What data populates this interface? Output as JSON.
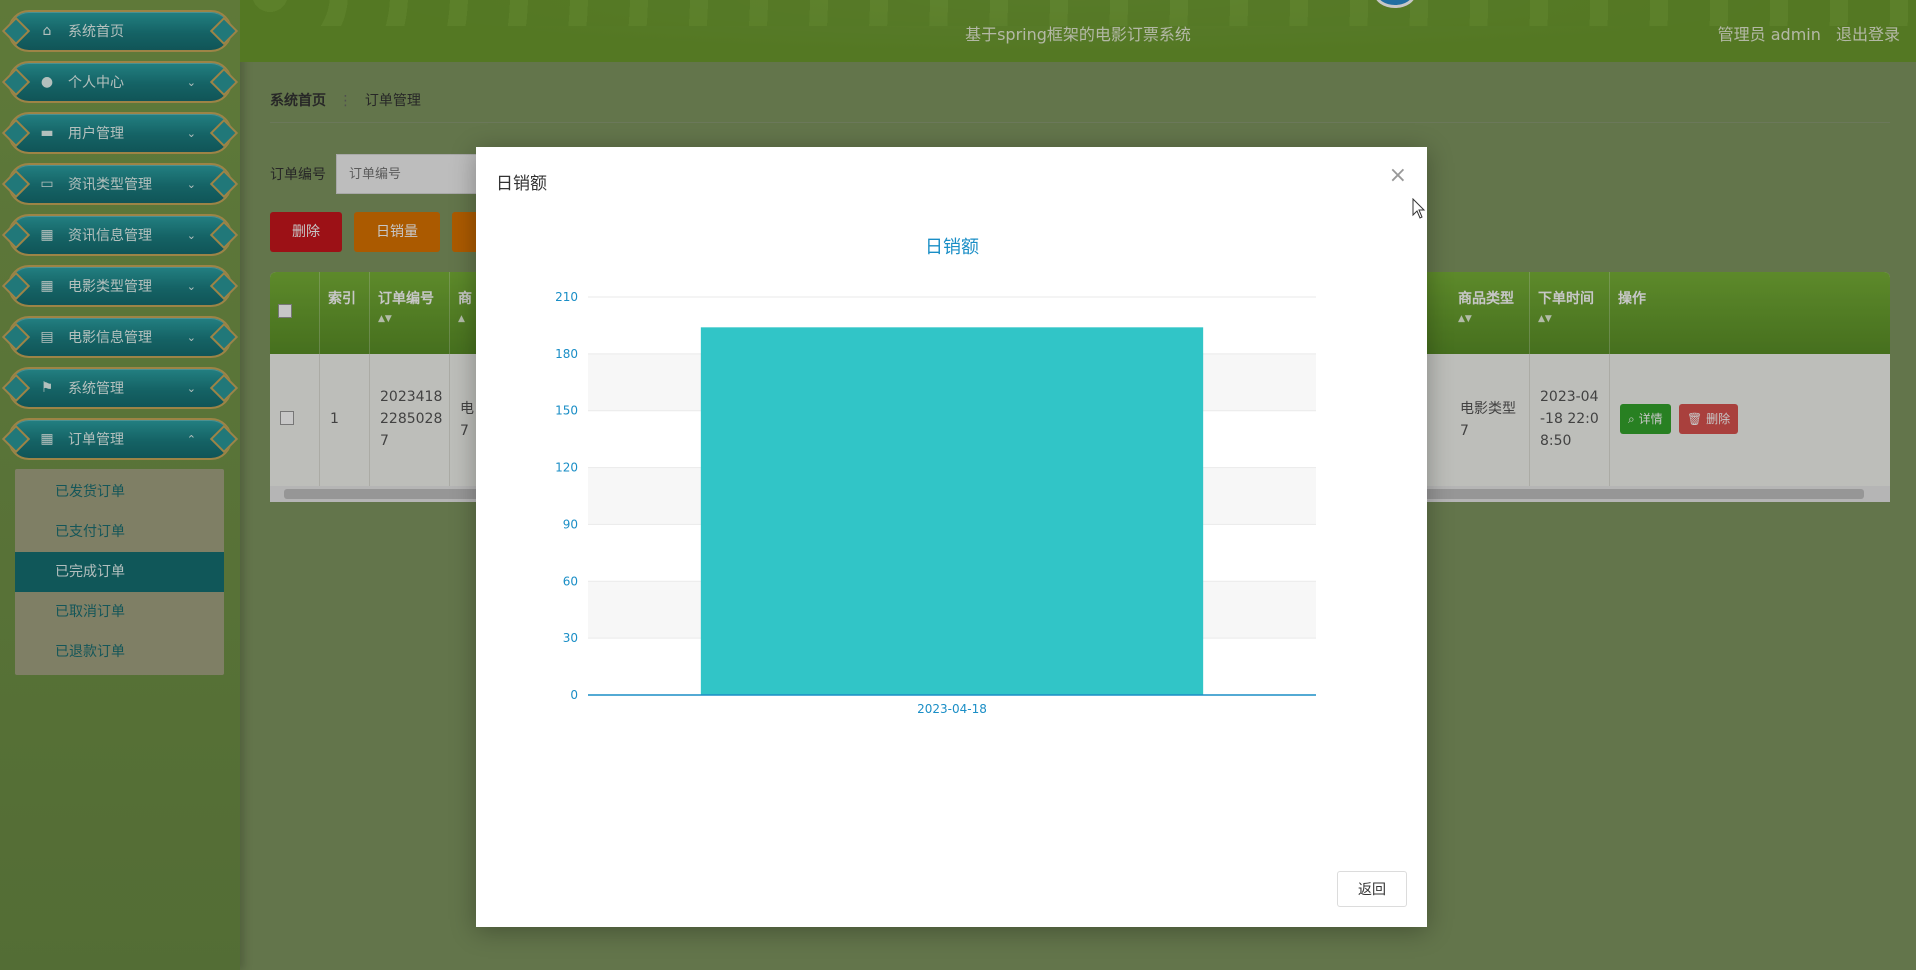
{
  "header": {
    "site_title": "基于spring框架的电影订票系统",
    "user_label": "管理员 admin",
    "logout_label": "退出登录"
  },
  "sidebar": {
    "items": [
      {
        "label": "系统首页",
        "icon": "home-icon",
        "chev": ""
      },
      {
        "label": "个人中心",
        "icon": "user-icon",
        "chev": "⌄"
      },
      {
        "label": "用户管理",
        "icon": "briefcase-icon",
        "chev": "⌄"
      },
      {
        "label": "资讯类型管理",
        "icon": "monitor-icon",
        "chev": "⌄"
      },
      {
        "label": "资讯信息管理",
        "icon": "grid-icon",
        "chev": "⌄"
      },
      {
        "label": "电影类型管理",
        "icon": "grid-icon",
        "chev": "⌄"
      },
      {
        "label": "电影信息管理",
        "icon": "clipboard-icon",
        "chev": "⌄"
      },
      {
        "label": "系统管理",
        "icon": "flag-icon",
        "chev": "⌄"
      },
      {
        "label": "订单管理",
        "icon": "grid-icon",
        "chev": "⌃"
      }
    ],
    "subitems": [
      {
        "label": "已发货订单"
      },
      {
        "label": "已支付订单"
      },
      {
        "label": "已完成订单"
      },
      {
        "label": "已取消订单"
      },
      {
        "label": "已退款订单"
      }
    ],
    "active_subitem": "已完成订单"
  },
  "breadcrumb": {
    "home": "系统首页",
    "current": "订单管理"
  },
  "search": {
    "label": "订单编号",
    "placeholder": "订单编号"
  },
  "buttons": {
    "delete": "删除",
    "daily_sales_qty": "日销量"
  },
  "table": {
    "headers": [
      "索引",
      "订单编号",
      "商",
      "商品类型",
      "下单时间",
      "操作"
    ],
    "row": {
      "index": "1",
      "order_no_1": "2023418",
      "order_no_2": "2285028",
      "order_no_3": "7",
      "goods_partial_1": "电",
      "goods_partial_2": "7",
      "goods_type_1": "电影类型",
      "goods_type_2": "7",
      "time_1": "2023-04",
      "time_2": "-18 22:0",
      "time_3": "8:50",
      "detail_btn": "详情",
      "delete_btn": "删除"
    }
  },
  "modal": {
    "title": "日销额",
    "close": "×",
    "return_label": "返回"
  },
  "chart_data": {
    "type": "bar",
    "title": "日销额",
    "categories": [
      "2023-04-18"
    ],
    "values": [
      194
    ],
    "ylim": [
      0,
      210
    ],
    "yticks": [
      0,
      30,
      60,
      90,
      120,
      150,
      180,
      210
    ],
    "bar_color": "#31c5c7",
    "axis_color": "#1a8ec6",
    "grid": true
  }
}
